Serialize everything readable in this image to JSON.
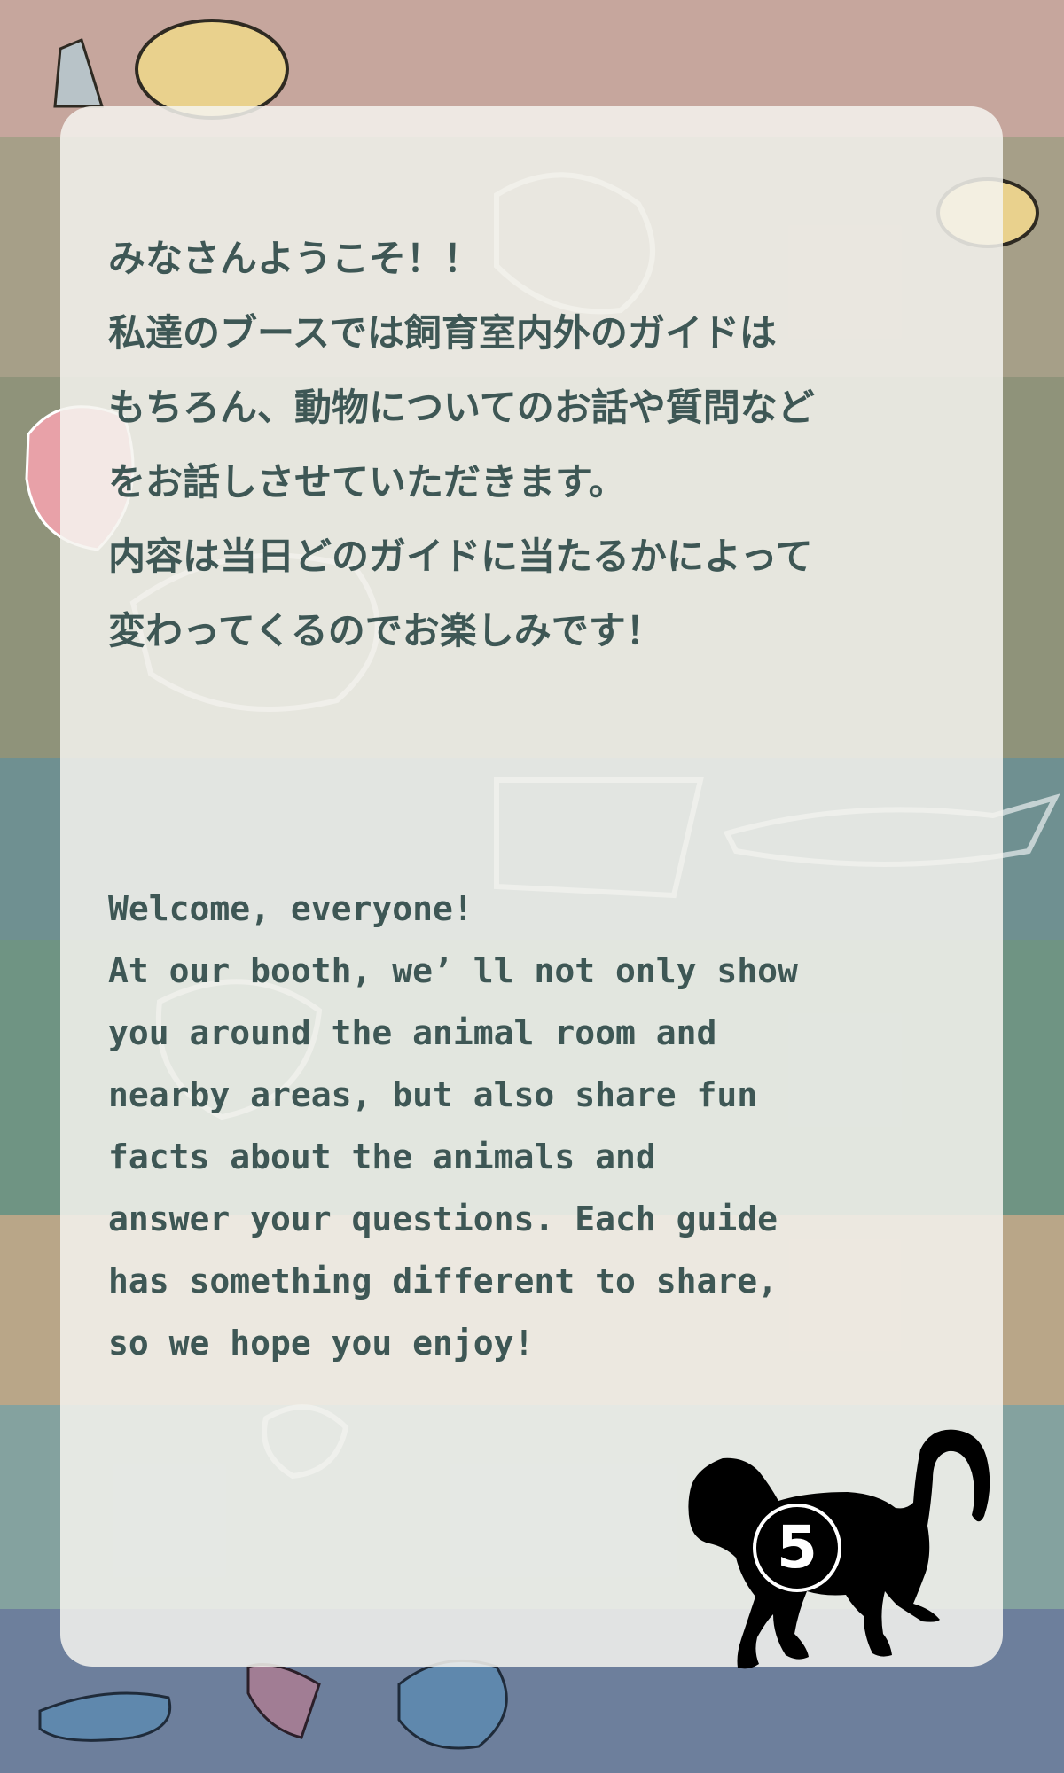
{
  "message": {
    "japanese_lines": [
      "みなさんようこそ！！",
      "私達のブースでは飼育室内外のガイドは",
      "もちろん、動物についてのお話や質問など",
      "をお話しさせていただきます。",
      "内容は当日どのガイドに当たるかによって",
      "変わってくるのでお楽しみです！"
    ],
    "english_lines": [
      "Welcome, everyone!",
      "At our booth, we’ ll not only show",
      "you around the animal room and",
      "nearby areas, but also share fun",
      "facts about the animals and",
      "answer your questions. Each guide",
      "has something different to share,",
      "so we hope you enjoy!"
    ]
  },
  "badge": {
    "number": "5",
    "icon": "monkey-silhouette-icon"
  },
  "colors": {
    "text": "#3e5755",
    "panel": "#f5f3ef",
    "monkey": "#000000"
  }
}
